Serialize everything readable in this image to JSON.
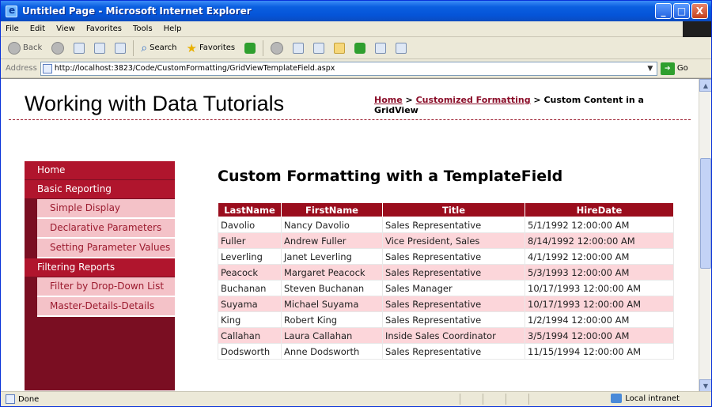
{
  "window": {
    "title": "Untitled Page - Microsoft Internet Explorer",
    "controls": {
      "minimize": "_",
      "maximize": "□",
      "close": "X"
    }
  },
  "menubar": {
    "items": [
      "File",
      "Edit",
      "View",
      "Favorites",
      "Tools",
      "Help"
    ]
  },
  "toolbar": {
    "back_label": "Back",
    "search_label": "Search",
    "favorites_label": "Favorites"
  },
  "addressbar": {
    "label": "Address",
    "url": "http://localhost:3823/Code/CustomFormatting/GridViewTemplateField.aspx",
    "go_label": "Go"
  },
  "site": {
    "title": "Working with Data Tutorials"
  },
  "breadcrumb": {
    "home": "Home",
    "sep1": " > ",
    "section": "Customized Formatting",
    "sep2": " > ",
    "current": "Custom Content in a GridView"
  },
  "sidebar": {
    "items": [
      {
        "label": "Home",
        "level": "top"
      },
      {
        "label": "Basic Reporting",
        "level": "top"
      },
      {
        "label": "Simple Display",
        "level": "sub"
      },
      {
        "label": "Declarative Parameters",
        "level": "sub"
      },
      {
        "label": "Setting Parameter Values",
        "level": "sub"
      },
      {
        "label": "Filtering Reports",
        "level": "top"
      },
      {
        "label": "Filter by Drop-Down List",
        "level": "sub"
      },
      {
        "label": "Master-Details-Details",
        "level": "sub"
      }
    ]
  },
  "main": {
    "title": "Custom Formatting with a TemplateField",
    "columns": [
      "LastName",
      "FirstName",
      "Title",
      "HireDate"
    ],
    "rows": [
      [
        "Davolio",
        "Nancy Davolio",
        "Sales Representative",
        "5/1/1992 12:00:00 AM"
      ],
      [
        "Fuller",
        "Andrew Fuller",
        "Vice President, Sales",
        "8/14/1992 12:00:00 AM"
      ],
      [
        "Leverling",
        "Janet Leverling",
        "Sales Representative",
        "4/1/1992 12:00:00 AM"
      ],
      [
        "Peacock",
        "Margaret Peacock",
        "Sales Representative",
        "5/3/1993 12:00:00 AM"
      ],
      [
        "Buchanan",
        "Steven Buchanan",
        "Sales Manager",
        "10/17/1993 12:00:00 AM"
      ],
      [
        "Suyama",
        "Michael Suyama",
        "Sales Representative",
        "10/17/1993 12:00:00 AM"
      ],
      [
        "King",
        "Robert King",
        "Sales Representative",
        "1/2/1994 12:00:00 AM"
      ],
      [
        "Callahan",
        "Laura Callahan",
        "Inside Sales Coordinator",
        "3/5/1994 12:00:00 AM"
      ],
      [
        "Dodsworth",
        "Anne Dodsworth",
        "Sales Representative",
        "11/15/1994 12:00:00 AM"
      ]
    ]
  },
  "statusbar": {
    "status": "Done",
    "zone": "Local intranet"
  },
  "colors": {
    "accent": "#9a0d1d",
    "sidebar_dark": "#7a0e22",
    "sidebar_top": "#b0152d",
    "sidebar_sub": "#f4c2c8",
    "alt_row": "#fcd6da"
  }
}
